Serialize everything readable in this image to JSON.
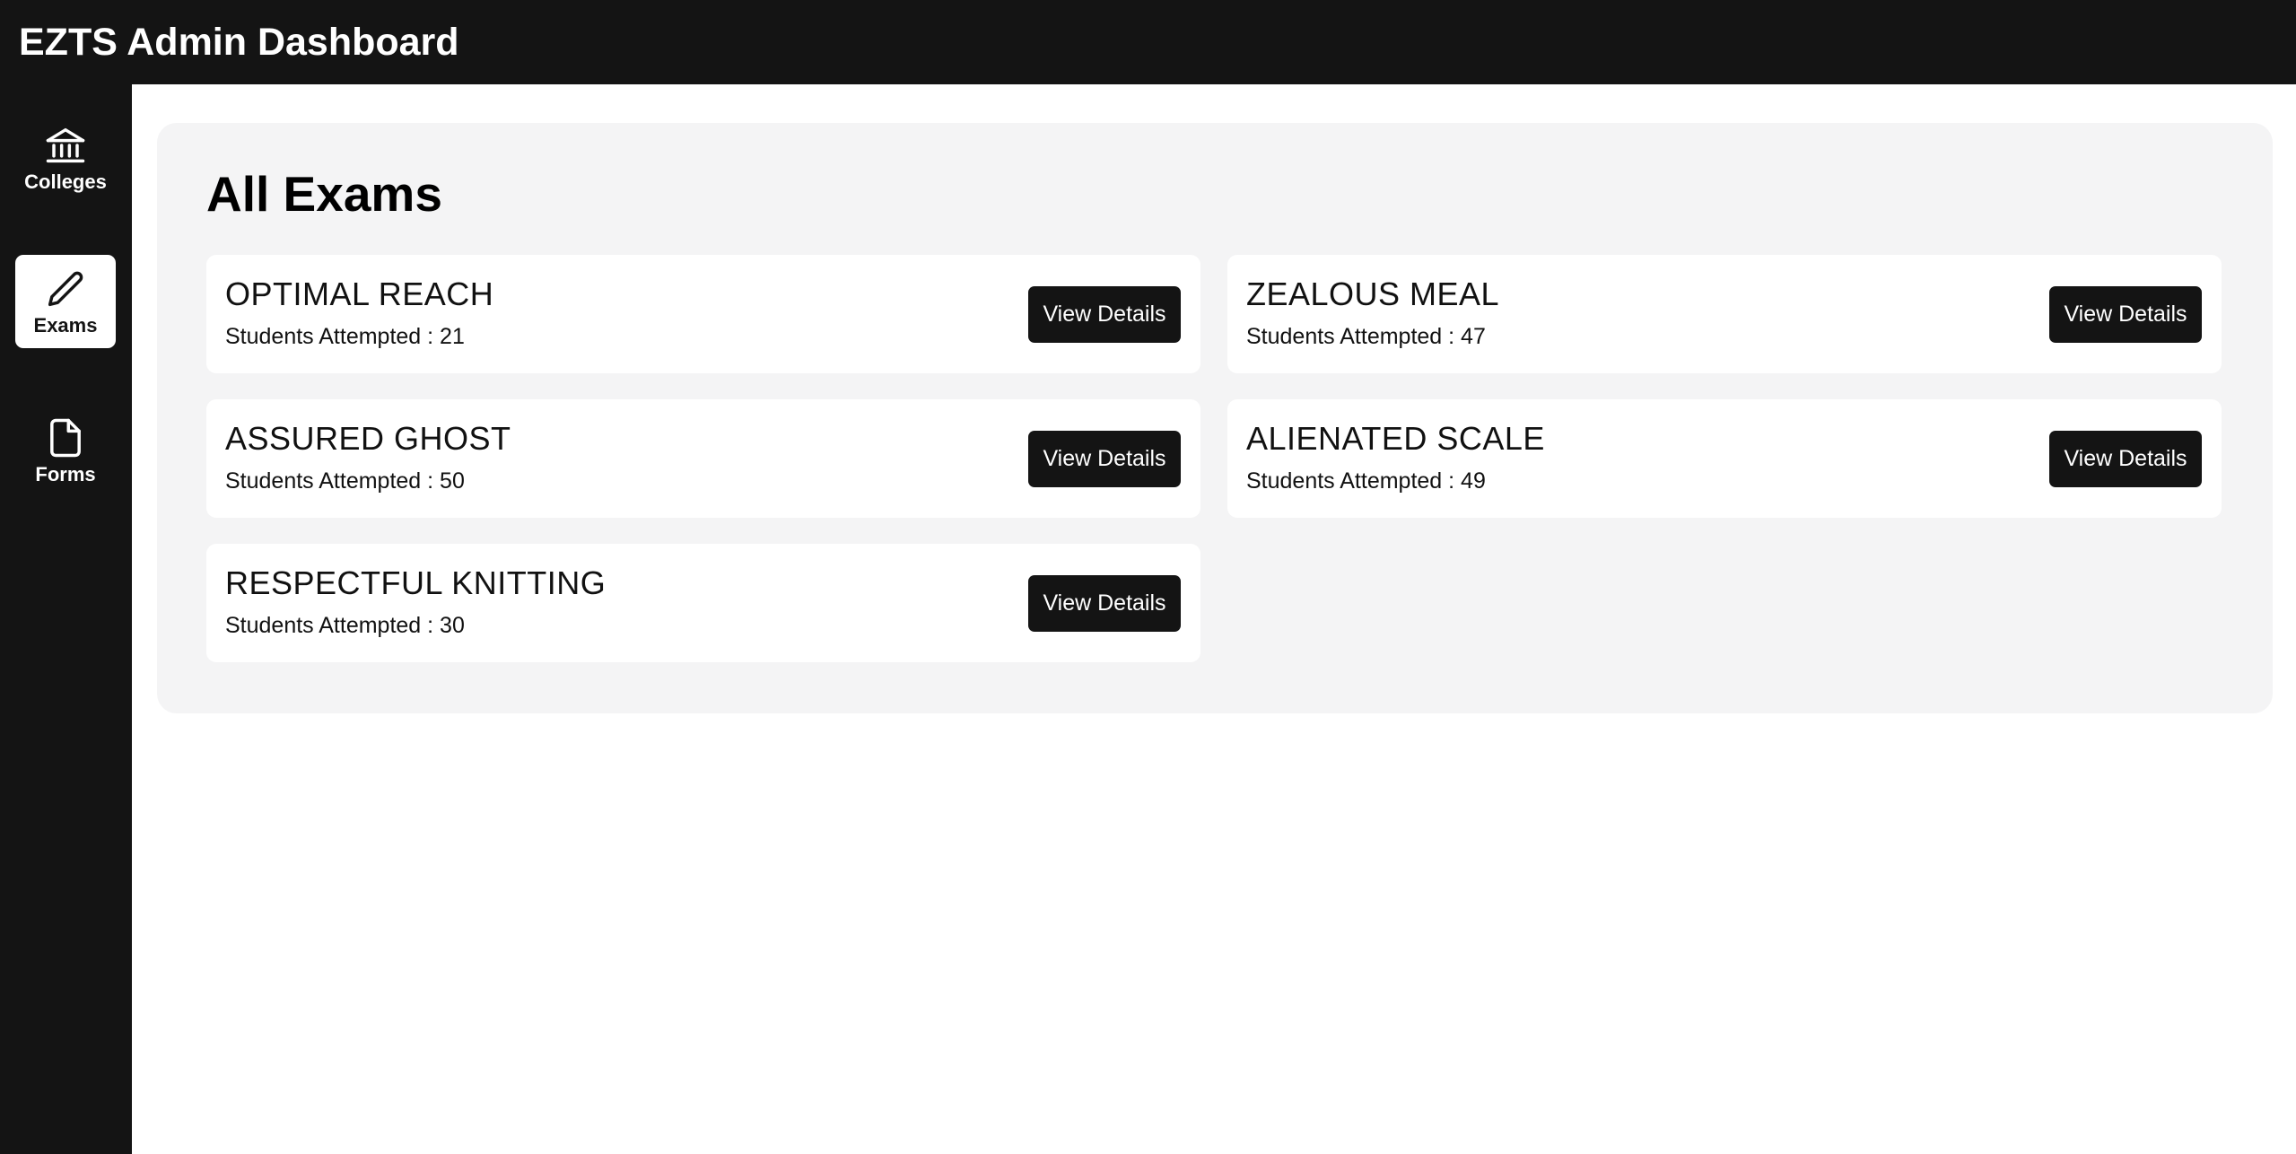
{
  "header": {
    "title": "EZTS Admin Dashboard"
  },
  "sidebar": {
    "items": [
      {
        "label": "Colleges",
        "icon": "bank-icon",
        "active": false
      },
      {
        "label": "Exams",
        "icon": "pencil-icon",
        "active": true
      },
      {
        "label": "Forms",
        "icon": "file-icon",
        "active": false
      }
    ]
  },
  "main": {
    "title": "All Exams",
    "attempts_label": "Students Attempted :",
    "button_label": "View Details",
    "exams": [
      {
        "name": "OPTIMAL REACH",
        "attempts": "21"
      },
      {
        "name": "ZEALOUS MEAL",
        "attempts": "47"
      },
      {
        "name": "ASSURED GHOST",
        "attempts": "50"
      },
      {
        "name": "ALIENATED SCALE",
        "attempts": "49"
      },
      {
        "name": "RESPECTFUL KNITTING",
        "attempts": "30"
      }
    ]
  },
  "colors": {
    "dark": "#141414",
    "panel": "#f4f4f5",
    "card": "#ffffff"
  }
}
